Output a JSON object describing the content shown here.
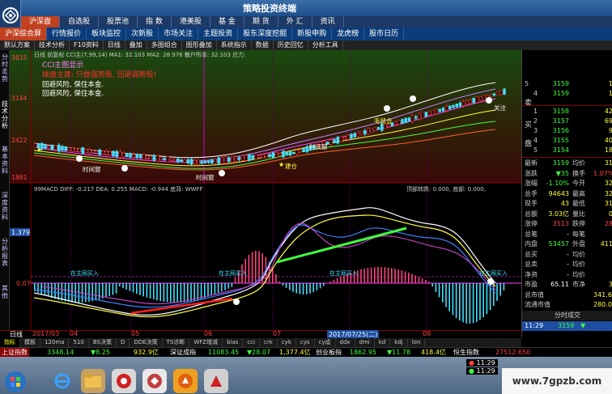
{
  "app": {
    "title": "策略投资终端"
  },
  "menu_top": [
    "沪深盘",
    "自选股",
    "股票池",
    "指 数",
    "港美股",
    "基 金",
    "期 货",
    "外 汇",
    "资讯"
  ],
  "menu_second": [
    "沪深综合屏",
    "行情报价",
    "板块监控",
    "次新股",
    "市场关注",
    "主题投资",
    "股东深度挖掘",
    "新股申购",
    "龙虎榜",
    "股市日历"
  ],
  "toolbar": [
    "默认方案",
    "技术分析",
    "F10资料",
    "日线",
    "叠加",
    "多图组合",
    "图形叠加",
    "系统指示",
    "数据",
    "历史回忆",
    "分析工具"
  ],
  "left_tabs": [
    "分时走势",
    "技术分析",
    "基本资料",
    "深度资料",
    "分析报表",
    "其他"
  ],
  "chart": {
    "kline_header": "CCI主图显示",
    "kline_indicators": "日线 前复权 CCI主(7,99,14) MA1: 32.103 MA2: 28.976 散户所本: 32.103 庄力:",
    "warn_text": "操盘主建: 只做强势股, 回避弱势股!",
    "risk_lines": [
      "回避风险, 保住本金.",
      "回避风险, 保住本金."
    ],
    "price_axis": [
      "3815",
      "3144",
      "2422",
      "1801"
    ],
    "labels": [
      "时间窗",
      "时间窗",
      "时间窗",
      "毛鼠会",
      "关注",
      "建仓",
      "时间窗",
      "时间窗",
      "时间窗"
    ],
    "macd_header": "99MACD DIFF: -0.217 DEA: 0.255 MACD: -0.944 底背: WWFF",
    "macd_right": "顶部转跌: 0.000, 底部: 0.000,",
    "macd_axis": [
      "1.379",
      "0.07"
    ],
    "macd_labels": [
      "在主网买入",
      "在主网买入",
      "在主网买入",
      "在主网买入"
    ],
    "date_labels": [
      "日线",
      "2017/03",
      "04",
      "05",
      "06",
      "07",
      "2017/07/25(二)",
      "08",
      "09"
    ]
  },
  "quote_panel": {
    "sell": [
      {
        "label": "5",
        "price": "3159",
        "vol": "1"
      },
      {
        "label": "4",
        "price": "3159",
        "vol": "1"
      }
    ],
    "sell_side": "卖",
    "buy": [
      {
        "label": "1",
        "price": "3158",
        "vol": "42"
      },
      {
        "label": "2",
        "price": "3157",
        "vol": "69"
      },
      {
        "label": "3",
        "price": "3156",
        "vol": "9"
      },
      {
        "label": "4",
        "price": "3155",
        "vol": "40"
      },
      {
        "label": "5",
        "price": "3154",
        "vol": "18"
      }
    ],
    "buy_side": "买",
    "pan_label": "盘",
    "stats": [
      {
        "l1": "最新",
        "v1": "3159",
        "l2": "均价",
        "v2": "31"
      },
      {
        "l1": "涨跌",
        "v1": "▼35",
        "l2": "换手",
        "v2": "1.07%"
      },
      {
        "l1": "涨幅",
        "v1": "-1.10%",
        "l2": "今开",
        "v2": "32"
      },
      {
        "l1": "总手",
        "v1": "94643",
        "l2": "最高",
        "v2": "32"
      },
      {
        "l1": "现手",
        "v1": "43",
        "l2": "最低",
        "v2": "31"
      },
      {
        "l1": "总额",
        "v1": "3.03亿",
        "l2": "量比",
        "v2": "0"
      },
      {
        "l1": "涨停",
        "v1": "3513",
        "l2": "跌停",
        "v2": "28"
      },
      {
        "l1": "总笔",
        "v1": "-",
        "l2": "每笔",
        "v2": ""
      },
      {
        "l1": "内盘",
        "v1": "53457",
        "l2": "外盘",
        "v2": "411"
      },
      {
        "l1": "总买",
        "v1": "-",
        "l2": "均价",
        "v2": ""
      },
      {
        "l1": "总卖",
        "v1": "-",
        "l2": "均价",
        "v2": ""
      },
      {
        "l1": "净资",
        "v1": "-",
        "l2": "均价",
        "v2": ""
      },
      {
        "l1": "市盈",
        "v1": "65.11",
        "l2": "市净",
        "v2": "3"
      },
      {
        "l1": "总市值",
        "v1": "",
        "l2": "",
        "v2": "341.67"
      },
      {
        "l1": "流通市值",
        "v1": "",
        "l2": "",
        "v2": "280.07"
      }
    ],
    "tick_header": "分时成交",
    "tick_time": "11:29",
    "tick_price": "3159",
    "tick_dir": "▼"
  },
  "formula_tabs": [
    "指标",
    "模板",
    "120ma",
    "510",
    "BS决策",
    "D",
    "DDE决策",
    "TS诊断",
    "WFZ增减",
    "bias",
    "cci",
    "crk",
    "cyk",
    "cys",
    "cy成",
    "ddx",
    "dmi",
    "kd",
    "kdj",
    "lon"
  ],
  "statusbar": {
    "sh_name": "上证指数",
    "sh_val": "3348.14",
    "sh_chg": "▼8.25",
    "sh_amt": "932.9亿",
    "sz_name": "深证成指",
    "sz_val": "11083.45",
    "sz_chg": "▼28.07",
    "sz_amt": "1,377.4亿",
    "cy_name": "创业板指",
    "cy_val": "1862.95",
    "cy_chg": "▼11.78",
    "cy_amt": "418.4亿",
    "hs_name": "恒生指数",
    "hs_val": "27512.650",
    "time1": "11:29",
    "time2": "11:29"
  },
  "watermark": "www.7gpzb.com"
}
